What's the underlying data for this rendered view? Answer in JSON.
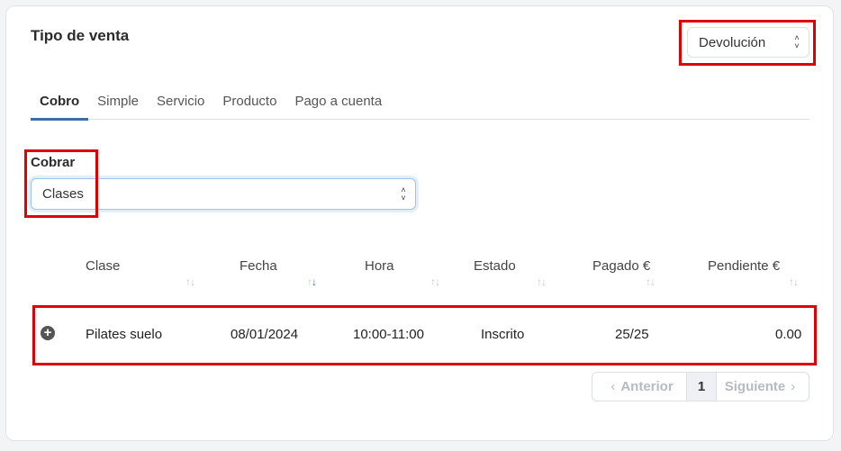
{
  "header": {
    "title": "Tipo de venta"
  },
  "sale_type_select": {
    "value": "Devolución"
  },
  "tabs": [
    {
      "label": "Cobro",
      "active": true
    },
    {
      "label": "Simple"
    },
    {
      "label": "Servicio"
    },
    {
      "label": "Producto"
    },
    {
      "label": "Pago a cuenta"
    }
  ],
  "cobrar": {
    "label": "Cobrar",
    "value": "Clases"
  },
  "table": {
    "columns": [
      "Clase",
      "Fecha",
      "Hora",
      "Estado",
      "Pagado €",
      "Pendiente €"
    ],
    "sorted_column": "Fecha",
    "rows": [
      {
        "clase": "Pilates suelo",
        "fecha": "08/01/2024",
        "hora": "10:00-11:00",
        "estado": "Inscrito",
        "pagado": "25/25",
        "pendiente": "0.00"
      }
    ]
  },
  "pagination": {
    "prev": "Anterior",
    "current": "1",
    "next": "Siguiente"
  },
  "colors": {
    "highlight": "#e00000",
    "active_tab": "#3a6ea5"
  }
}
